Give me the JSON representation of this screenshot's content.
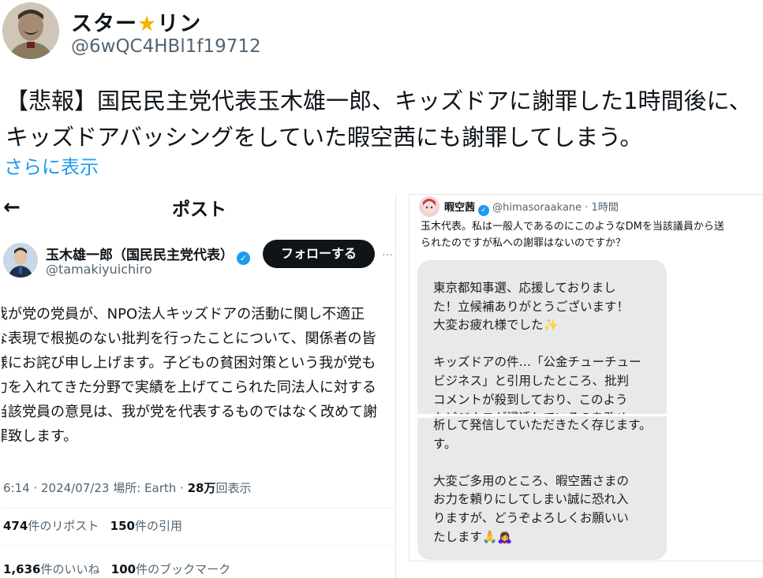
{
  "outer": {
    "display_name_a": "スター",
    "display_name_b": "リン",
    "handle": "@6wQC4HBl1f19712",
    "body_line1": "【悲報】国民民主党代表玉木雄一郎、キッズドアに謝罪した1時間後に、",
    "body_line2": "キッズドアバッシングをしていた暇空茜にも謝罪してしまう。",
    "show_more": "さらに表示"
  },
  "left_post": {
    "back_arrow": "←",
    "title": "ポスト",
    "name": "玉木雄一郎（国民民主党代表）",
    "handle": "@tamakiyuichiro",
    "follow_label": "フォローする",
    "more": "…",
    "body_lines": [
      "我が党の党員が、NPO法人キッズドアの活動に関し不適正",
      "な表現で根拠のない批判を行ったことについて、関係者の皆",
      "様にお詫び申し上げます。子どもの貧困対策という我が党も",
      "力を入れてきた分野で実績を上げてこられた同法人に対する",
      "当該党員の意見は、我が党を代表するものではなく改めて謝",
      "罪致します。"
    ],
    "meta_time": "6:14 · 2024/07/23 場所: Earth · ",
    "meta_views_num": "28万",
    "meta_views_label": "回表示",
    "reposts_num": "474",
    "reposts_label": "件のリポスト",
    "quotes_num": "150",
    "quotes_label": "件の引用",
    "likes_num": "1,636",
    "likes_label": "件のいいね",
    "bookmarks_num": "100",
    "bookmarks_label": "件のブックマーク"
  },
  "right_post": {
    "name": "暇空茜",
    "handle_time": "@himasoraakane · 1時間",
    "text_line1": "玉木代表。私は一般人であるのにこのようなDMを当該議員から送",
    "text_line2": "られたのですが私への謝罪はないのですか？",
    "dm_part1": "東京都知事選、応援しておりまし\nた！立候補ありがとうございます！\n大変お疲れ様でした✨\n\nキッズドアの件…「公金チューチュー\nビジネス」と引用したところ、批判\nコメントが殺到しており、このよう\nなビジネスが浸透しているのを改め",
    "dm_part2": "析して発信していただきたく存じます。\nす。\n\n大変ご多用のところ、暇空茜さまの\nお力を頼りにしてしまい誠に恐れ入\nりますが、どうぞよろしくお願いい\nたします🙏🙇‍♀️"
  },
  "icons": {
    "verified": "verified-badge-icon",
    "star": "star-icon"
  },
  "colors": {
    "link": "#1d9bf0",
    "star": "#f5b400",
    "follow_bg": "#0f1419",
    "dm_bubble": "#e9e9eb"
  }
}
